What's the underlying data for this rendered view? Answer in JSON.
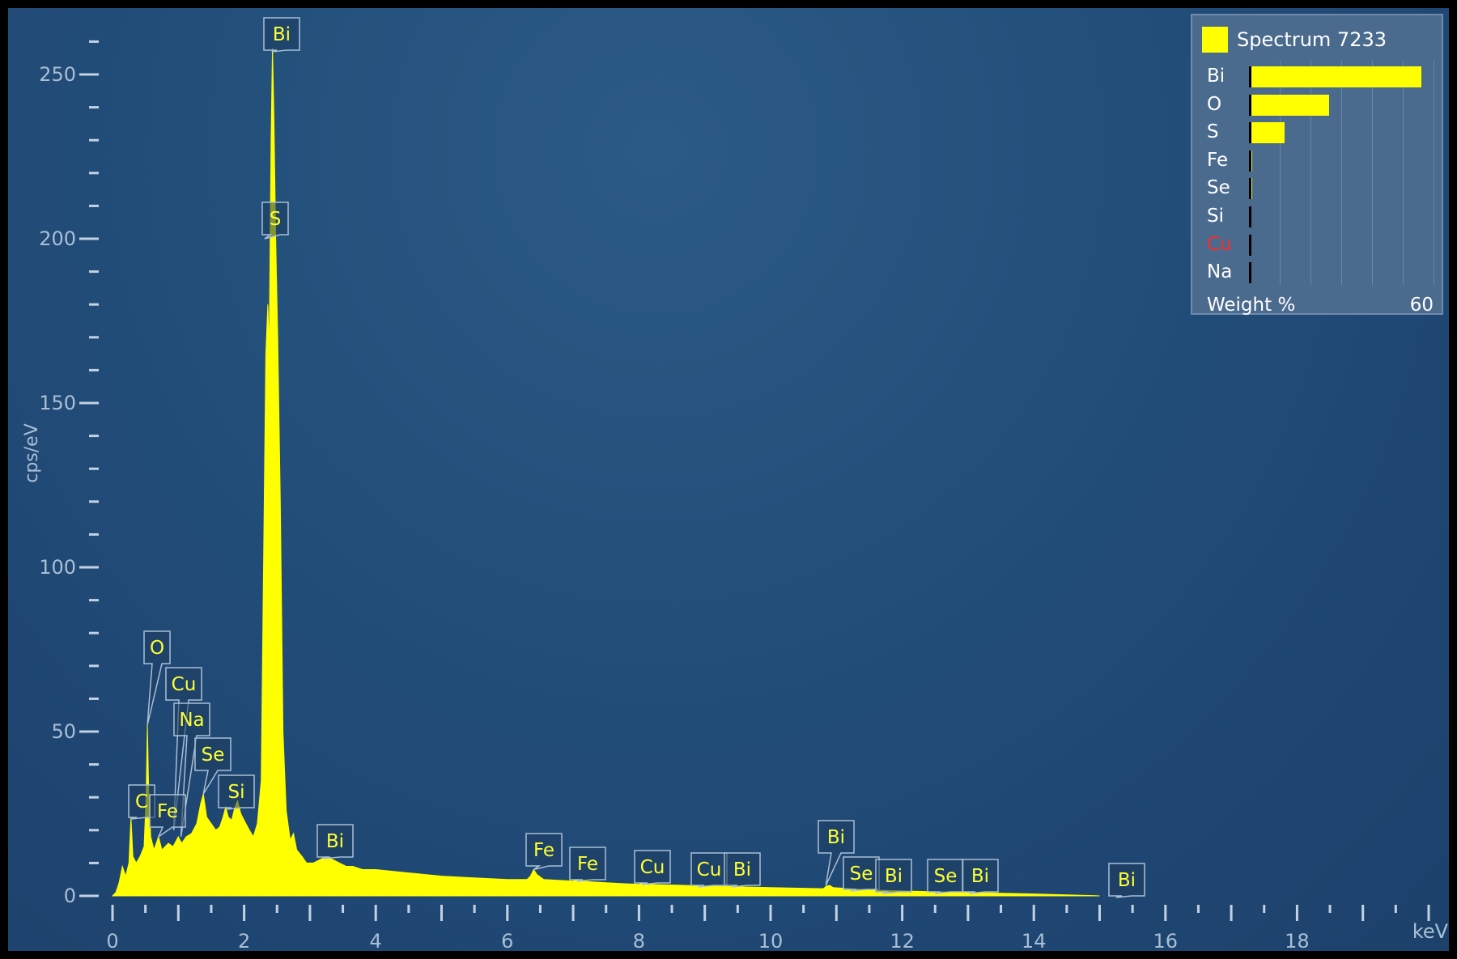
{
  "chart_data": {
    "type": "area",
    "ylabel": "cps/eV",
    "xlabel": "keV",
    "xlim": [
      0,
      20
    ],
    "ylim": [
      0,
      260
    ],
    "x_ticks": [
      0,
      2,
      4,
      6,
      8,
      10,
      12,
      14,
      16,
      18
    ],
    "y_ticks": [
      0,
      50,
      100,
      150,
      200,
      250
    ],
    "series_color": "#ffff00",
    "spectrum": [
      [
        0.0,
        0
      ],
      [
        0.05,
        1
      ],
      [
        0.1,
        4
      ],
      [
        0.15,
        9
      ],
      [
        0.2,
        6
      ],
      [
        0.25,
        10
      ],
      [
        0.28,
        24
      ],
      [
        0.31,
        12
      ],
      [
        0.36,
        10
      ],
      [
        0.42,
        12
      ],
      [
        0.48,
        15
      ],
      [
        0.51,
        30
      ],
      [
        0.53,
        52
      ],
      [
        0.55,
        32
      ],
      [
        0.58,
        18
      ],
      [
        0.63,
        14
      ],
      [
        0.7,
        18
      ],
      [
        0.75,
        14
      ],
      [
        0.8,
        15
      ],
      [
        0.85,
        16
      ],
      [
        0.92,
        15
      ],
      [
        1.0,
        18
      ],
      [
        1.05,
        16
      ],
      [
        1.12,
        18
      ],
      [
        1.2,
        19
      ],
      [
        1.28,
        22
      ],
      [
        1.34,
        28
      ],
      [
        1.38,
        31
      ],
      [
        1.43,
        24
      ],
      [
        1.5,
        22
      ],
      [
        1.57,
        20
      ],
      [
        1.63,
        21
      ],
      [
        1.68,
        24
      ],
      [
        1.72,
        27
      ],
      [
        1.76,
        24
      ],
      [
        1.81,
        23
      ],
      [
        1.86,
        27
      ],
      [
        1.9,
        29
      ],
      [
        1.95,
        25
      ],
      [
        2.0,
        23
      ],
      [
        2.08,
        20
      ],
      [
        2.14,
        18
      ],
      [
        2.2,
        22
      ],
      [
        2.26,
        35
      ],
      [
        2.3,
        110
      ],
      [
        2.33,
        165
      ],
      [
        2.36,
        180
      ],
      [
        2.38,
        165
      ],
      [
        2.41,
        230
      ],
      [
        2.43,
        258
      ],
      [
        2.45,
        240
      ],
      [
        2.48,
        200
      ],
      [
        2.51,
        170
      ],
      [
        2.55,
        120
      ],
      [
        2.59,
        50
      ],
      [
        2.64,
        26
      ],
      [
        2.7,
        17
      ],
      [
        2.75,
        19
      ],
      [
        2.8,
        14
      ],
      [
        2.88,
        12
      ],
      [
        2.95,
        10
      ],
      [
        3.05,
        10
      ],
      [
        3.15,
        11
      ],
      [
        3.25,
        12
      ],
      [
        3.35,
        11
      ],
      [
        3.45,
        10
      ],
      [
        3.55,
        9
      ],
      [
        3.65,
        9
      ],
      [
        3.8,
        8
      ],
      [
        4.0,
        8
      ],
      [
        4.5,
        7
      ],
      [
        5.0,
        6
      ],
      [
        5.5,
        5.5
      ],
      [
        6.0,
        5
      ],
      [
        6.3,
        5
      ],
      [
        6.35,
        6
      ],
      [
        6.4,
        8
      ],
      [
        6.45,
        6.5
      ],
      [
        6.55,
        5
      ],
      [
        7.0,
        4.5
      ],
      [
        7.05,
        5
      ],
      [
        7.1,
        4.5
      ],
      [
        7.5,
        4
      ],
      [
        8.0,
        3.5
      ],
      [
        8.05,
        4
      ],
      [
        8.15,
        3.5
      ],
      [
        9.0,
        3
      ],
      [
        10.0,
        2.5
      ],
      [
        10.8,
        2.2
      ],
      [
        10.85,
        3
      ],
      [
        10.9,
        3.2
      ],
      [
        10.95,
        2.5
      ],
      [
        11.5,
        1.8
      ],
      [
        12.0,
        1.5
      ],
      [
        13.0,
        1
      ],
      [
        14.0,
        0.6
      ],
      [
        14.5,
        0.3
      ],
      [
        14.9,
        0.1
      ],
      [
        15.0,
        0
      ]
    ],
    "peak_labels": [
      {
        "text": "Bi",
        "x": 2.42,
        "y": 258
      },
      {
        "text": "S",
        "x": 2.31,
        "y": 200
      },
      {
        "text": "O",
        "x": 0.53,
        "y": 52
      },
      {
        "text": "Cu",
        "x": 0.93,
        "y": 20
      },
      {
        "text": "Na",
        "x": 1.04,
        "y": 18
      },
      {
        "text": "Se",
        "x": 1.38,
        "y": 31
      },
      {
        "text": "Si",
        "x": 1.74,
        "y": 27
      },
      {
        "text": "C",
        "x": 0.28,
        "y": 24
      },
      {
        "text": "Fe",
        "x": 0.7,
        "y": 18
      },
      {
        "text": "Bi",
        "x": 3.2,
        "y": 12
      },
      {
        "text": "Fe",
        "x": 6.4,
        "y": 8
      },
      {
        "text": "Fe",
        "x": 7.06,
        "y": 5
      },
      {
        "text": "Cu",
        "x": 8.05,
        "y": 4
      },
      {
        "text": "Cu",
        "x": 8.9,
        "y": 3
      },
      {
        "text": "Bi",
        "x": 9.42,
        "y": 3
      },
      {
        "text": "Bi",
        "x": 10.84,
        "y": 3.2
      },
      {
        "text": "Se",
        "x": 11.22,
        "y": 1.8
      },
      {
        "text": "Bi",
        "x": 11.71,
        "y": 1.6
      },
      {
        "text": "Se",
        "x": 12.5,
        "y": 1.3
      },
      {
        "text": "Bi",
        "x": 13.02,
        "y": 1.1
      },
      {
        "text": "Bi",
        "x": 15.25,
        "y": 0
      }
    ]
  },
  "legend": {
    "title": "Spectrum 7233",
    "axis_label": "Weight %",
    "axis_max_label": "60",
    "axis_max": 60,
    "elements": [
      {
        "symbol": "Bi",
        "weight": 58,
        "color": "#ffffff"
      },
      {
        "symbol": "O",
        "weight": 27,
        "color": "#ffffff"
      },
      {
        "symbol": "S",
        "weight": 12,
        "color": "#ffffff"
      },
      {
        "symbol": "Fe",
        "weight": 1.2,
        "color": "#ffffff"
      },
      {
        "symbol": "Se",
        "weight": 1.0,
        "color": "#ffffff"
      },
      {
        "symbol": "Si",
        "weight": 0,
        "color": "#ffffff"
      },
      {
        "symbol": "Cu",
        "weight": 0,
        "color": "#ff2a2a"
      },
      {
        "symbol": "Na",
        "weight": 0,
        "color": "#ffffff"
      }
    ]
  }
}
